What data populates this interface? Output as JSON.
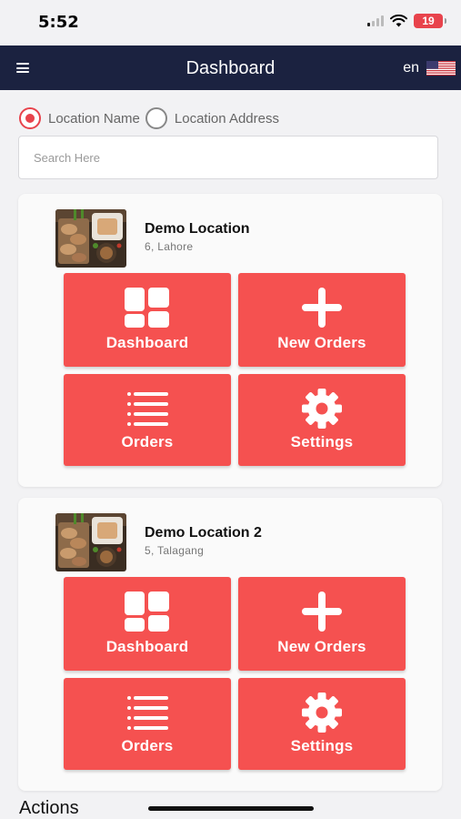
{
  "status_bar": {
    "time": "5:52",
    "battery": "19"
  },
  "header": {
    "title": "Dashboard",
    "language": "en",
    "menu_icon": "hamburger-menu-icon",
    "flag_icon": "us-flag-icon"
  },
  "search_mode": {
    "options": [
      {
        "label": "Location Name",
        "selected": true
      },
      {
        "label": "Location Address",
        "selected": false
      }
    ]
  },
  "search": {
    "placeholder": "Search Here",
    "value": ""
  },
  "locations": [
    {
      "name": "Demo Location",
      "address": "6, Lahore",
      "tiles": [
        {
          "label": "Dashboard",
          "icon": "dashboard-grid-icon"
        },
        {
          "label": "New Orders",
          "icon": "plus-icon"
        },
        {
          "label": "Orders",
          "icon": "list-icon"
        },
        {
          "label": "Settings",
          "icon": "gear-icon"
        }
      ]
    },
    {
      "name": "Demo Location 2",
      "address": "5, Talagang",
      "tiles": [
        {
          "label": "Dashboard",
          "icon": "dashboard-grid-icon"
        },
        {
          "label": "New Orders",
          "icon": "plus-icon"
        },
        {
          "label": "Orders",
          "icon": "list-icon"
        },
        {
          "label": "Settings",
          "icon": "gear-icon"
        }
      ]
    }
  ],
  "actions": {
    "heading": "Actions"
  },
  "colors": {
    "header_bg": "#1b2240",
    "accent": "#f55150",
    "radio_selected": "#e8434c"
  }
}
